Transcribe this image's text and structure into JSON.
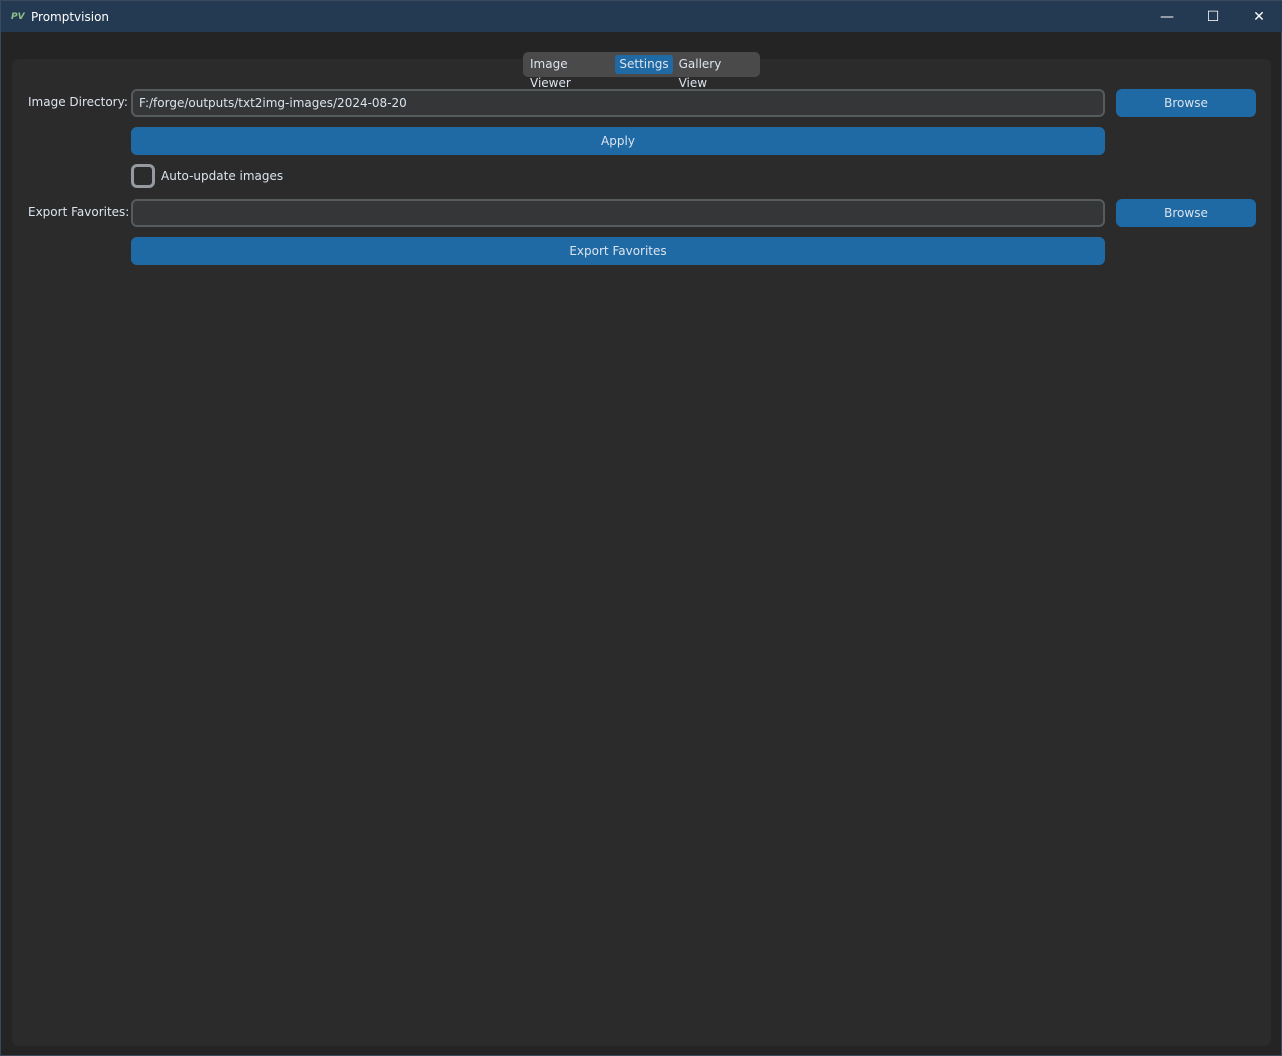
{
  "window": {
    "logo": "PV",
    "title": "Promptvision",
    "controls": [
      "minimize-icon",
      "maximize-icon",
      "close-icon"
    ]
  },
  "tabs": [
    {
      "label": "Image Viewer"
    },
    {
      "label": "Settings",
      "selected": true
    },
    {
      "label": "Gallery View"
    }
  ],
  "settings": {
    "image_directory_label": "Image Directory:",
    "image_directory_value": "F:/forge/outputs/txt2img-images/2024-08-20",
    "browse_label": "Browse",
    "apply_label": "Apply",
    "auto_update_label": "Auto-update images",
    "auto_update_checked": false,
    "export_favorites_label": "Export Favorites:",
    "export_favorites_value": "",
    "export_button_label": "Export Favorites"
  },
  "colors": {
    "accent": "#1f6aa5",
    "titlebar": "#233a52"
  }
}
